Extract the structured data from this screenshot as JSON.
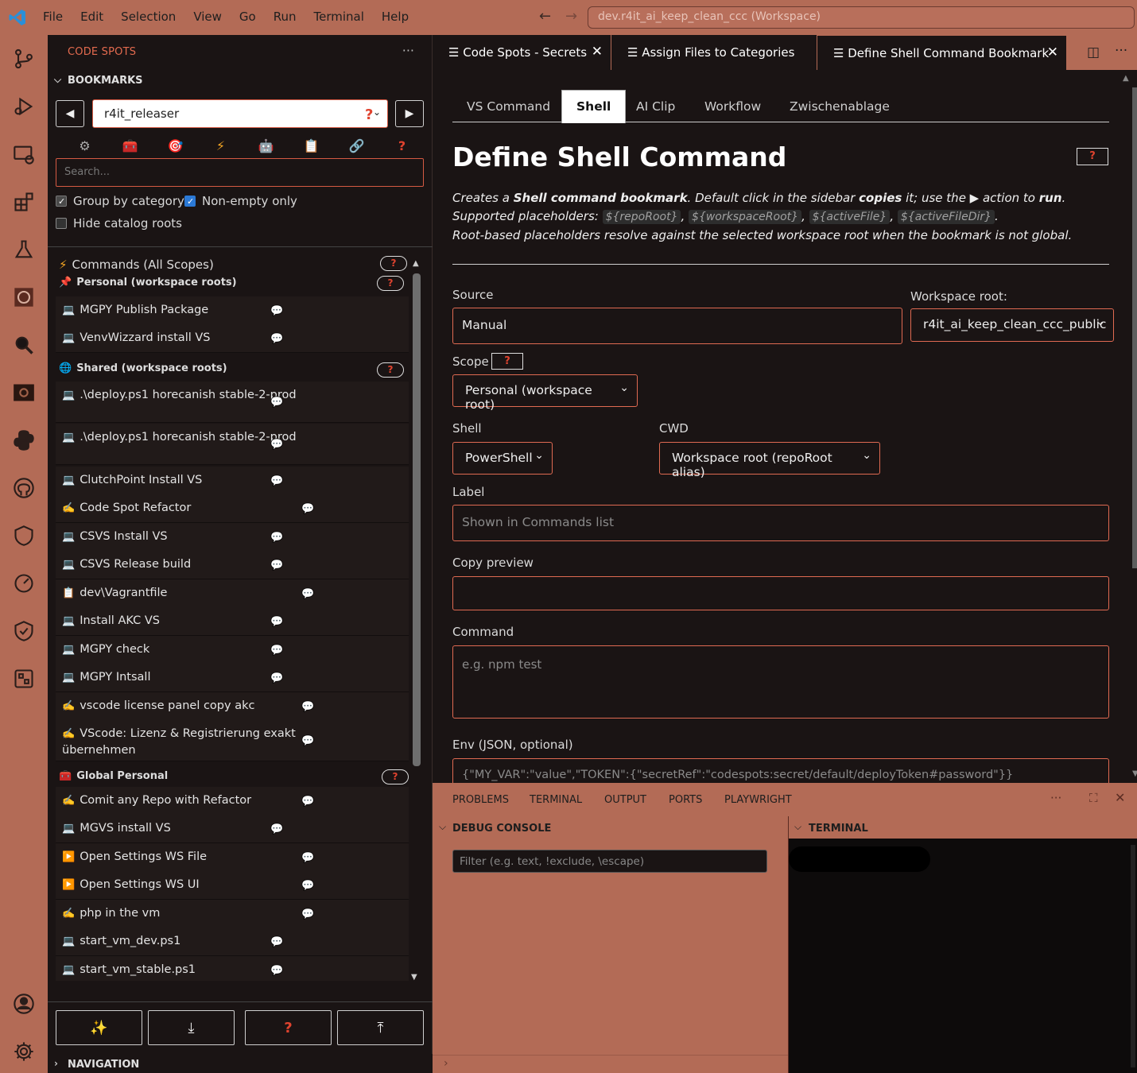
{
  "titlebar": {
    "menu": [
      "File",
      "Edit",
      "Selection",
      "View",
      "Go",
      "Run",
      "Terminal",
      "Help"
    ],
    "workspace": "dev.r4it_ai_keep_clean_ccc (Workspace)"
  },
  "sidebar": {
    "title": "CODE SPOTS",
    "section_bookmarks": "BOOKMARKS",
    "section_navigation": "NAVIGATION",
    "selected_project": "r4it_releaser",
    "search_placeholder": "Search...",
    "checks": {
      "group_by_category": "Group by category",
      "non_empty_only": "Non-empty only",
      "hide_catalog_roots": "Hide catalog roots"
    },
    "commands_header": "Commands (All Scopes)",
    "groups": {
      "personal": "Personal (workspace roots)",
      "shared": "Shared (workspace roots)",
      "global": "Global Personal"
    },
    "personal_items": [
      "MGPY Publish Package",
      "VenvWizzard install VS"
    ],
    "shared_items": [
      ".\\deploy.ps1 horecanish stable-2-prod",
      ".\\deploy.ps1 horecanish stable-2-prod",
      "ClutchPoint Install VS",
      "Code Spot Refactor",
      "CSVS Install VS",
      "CSVS Release build",
      "dev\\Vagrantfile",
      "Install AKC VS",
      "MGPY check",
      "MGPY Intsall",
      "vscode license panel copy akc",
      "VScode: Lizenz & Registrierung exakt übernehmen"
    ],
    "global_items": [
      "Comit any Repo with Refactor",
      "MGVS install VS",
      "Open Settings WS File",
      "Open Settings WS UI",
      "php in the vm",
      "start_vm_dev.ps1",
      "start_vm_stable.ps1"
    ],
    "bottom_buttons": [
      "✨",
      "⤓",
      "?",
      "⤒"
    ]
  },
  "tabs": [
    {
      "label": "Code Spots - Secrets"
    },
    {
      "label": "Assign Files to Categories"
    },
    {
      "label": "Define Shell Command Bookmark"
    }
  ],
  "editor": {
    "wtabs": [
      "VS Command",
      "Shell",
      "AI Clip",
      "Workflow",
      "Zwischenablage"
    ],
    "heading": "Define Shell Command",
    "desc1_a": "Creates a ",
    "desc1_b": "Shell command bookmark",
    "desc1_c": ". Default click in the sidebar ",
    "desc1_d": "copies",
    "desc1_e": " it; use the ▶ action to ",
    "desc1_f": "run",
    "desc1_g": ".",
    "desc2": "Supported placeholders:",
    "placeholders": [
      "${repoRoot}",
      "${workspaceRoot}",
      "${activeFile}",
      "${activeFileDir}"
    ],
    "desc3": "Root-based placeholders resolve against the selected workspace root when the bookmark is not global.",
    "source_label": "Source",
    "source_value": "Manual",
    "wsroot_label": "Workspace root:",
    "wsroot_value": "r4it_ai_keep_clean_ccc_public",
    "scope_label": "Scope",
    "scope_value": "Personal (workspace root)",
    "shell_label": "Shell",
    "shell_value": "PowerShell",
    "cwd_label": "CWD",
    "cwd_value": "Workspace root (repoRoot alias)",
    "label_label": "Label",
    "label_placeholder": "Shown in Commands list",
    "copy_label": "Copy preview",
    "command_label": "Command",
    "command_placeholder": "e.g. npm test",
    "env_label": "Env (JSON, optional)",
    "env_placeholder": "{\"MY_VAR\":\"value\",\"TOKEN\":{\"secretRef\":\"codespots:secret/default/deployToken#password\"}}"
  },
  "panel": {
    "tabs": [
      "PROBLEMS",
      "TERMINAL",
      "OUTPUT",
      "PORTS",
      "PLAYWRIGHT"
    ],
    "debug_console": "DEBUG CONSOLE",
    "terminal": "TERMINAL",
    "filter_placeholder": "Filter (e.g. text, !exclude, \\escape)"
  }
}
